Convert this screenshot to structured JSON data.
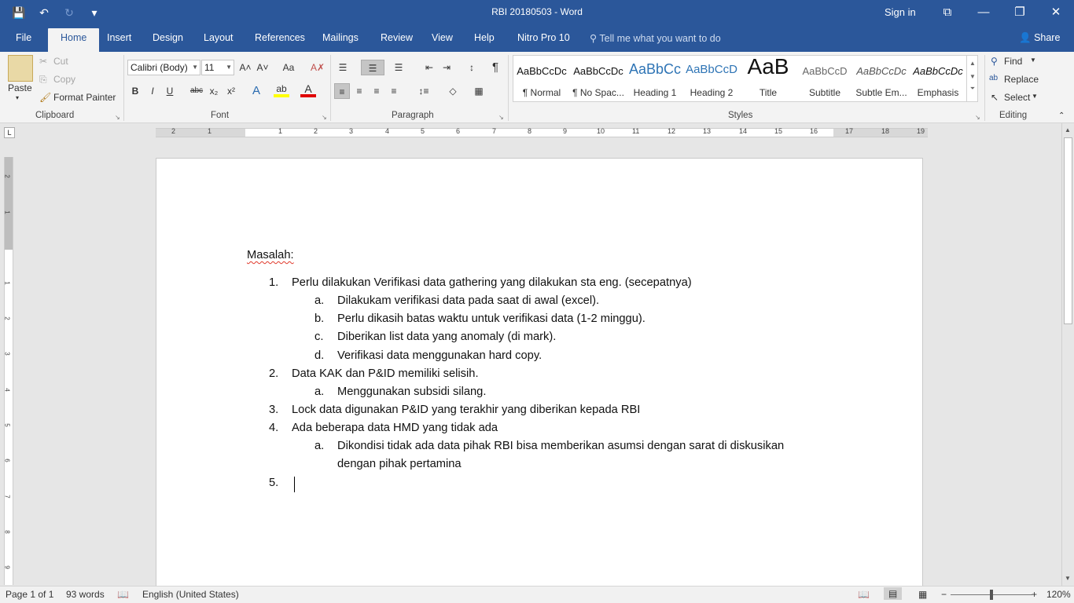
{
  "window": {
    "title": "RBI 20180503  -  Word",
    "signin": "Sign in",
    "btn_ribbon_display": "⧉",
    "btn_minimize": "—",
    "btn_restore": "❐",
    "btn_close": "✕"
  },
  "qat": {
    "save": "💾",
    "undo": "↶",
    "redo": "↻",
    "customize": "▾"
  },
  "tabs": [
    "File",
    "Home",
    "Insert",
    "Design",
    "Layout",
    "References",
    "Mailings",
    "Review",
    "View",
    "Help",
    "Nitro Pro 10"
  ],
  "tellme": {
    "icon": "⚲",
    "placeholder": "Tell me what you want to do"
  },
  "share": {
    "icon": "👤",
    "label": "Share"
  },
  "clipboard": {
    "paste": "Paste",
    "cut": "Cut",
    "copy": "Copy",
    "format_painter": "Format Painter",
    "group": "Clipboard"
  },
  "font": {
    "name": "Calibri (Body)",
    "size": "11",
    "grow": "A˄",
    "shrink": "A˅",
    "case": "Aa",
    "clear": "A✗",
    "bold": "B",
    "italic": "I",
    "underline": "U",
    "strike": "abc",
    "subscript": "x₂",
    "superscript": "x²",
    "effects": "A",
    "highlight": "ab",
    "color": "A",
    "group": "Font"
  },
  "paragraph": {
    "bullets": "☰",
    "numbering": "☰",
    "multilevel": "☰",
    "dec_indent": "⇤",
    "inc_indent": "⇥",
    "sort": "↕",
    "pilcrow": "¶",
    "align_left": "≡",
    "center": "≡",
    "align_right": "≡",
    "justify": "≡",
    "line_spacing": "↕≡",
    "shading": "◇",
    "borders": "▦",
    "group": "Paragraph"
  },
  "styles": {
    "group": "Styles",
    "items": [
      {
        "preview": "AaBbCcDc",
        "name": "¶ Normal"
      },
      {
        "preview": "AaBbCcDc",
        "name": "¶ No Spac..."
      },
      {
        "preview": "AaBbCc",
        "name": "Heading 1"
      },
      {
        "preview": "AaBbCcD",
        "name": "Heading 2"
      },
      {
        "preview": "AaB",
        "name": "Title"
      },
      {
        "preview": "AaBbCcD",
        "name": "Subtitle"
      },
      {
        "preview": "AaBbCcDc",
        "name": "Subtle Em..."
      },
      {
        "preview": "AaBbCcDc",
        "name": "Emphasis"
      }
    ]
  },
  "editing": {
    "find": "Find",
    "replace": "Replace",
    "select": "Select",
    "group": "Editing"
  },
  "ruler": {
    "tab_selector": "L",
    "numbers": [
      "2",
      "1",
      "1",
      "2",
      "3",
      "4",
      "5",
      "6",
      "7",
      "8",
      "9",
      "10",
      "11",
      "12",
      "13",
      "14",
      "15",
      "16",
      "17",
      "18",
      "19"
    ],
    "vnumbers": [
      "2",
      "1",
      "1",
      "2",
      "3",
      "4",
      "5",
      "6",
      "7",
      "8",
      "9"
    ]
  },
  "document": {
    "heading": "Masalah:",
    "items": [
      {
        "num": "1.",
        "level": 1,
        "text": "Perlu dilakukan Verifikasi data gathering yang dilakukan sta eng. (secepatnya)"
      },
      {
        "num": "a.",
        "level": 2,
        "text": "Dilakukam verifikasi data pada saat di awal (excel)."
      },
      {
        "num": "b.",
        "level": 2,
        "text": "Perlu dikasih batas waktu untuk verifikasi data (1-2 minggu)."
      },
      {
        "num": "c.",
        "level": 2,
        "text": "Diberikan list data yang anomaly (di mark)."
      },
      {
        "num": "d.",
        "level": 2,
        "text": "Verifikasi data menggunakan hard copy."
      },
      {
        "num": "2.",
        "level": 1,
        "text": "Data KAK dan P&ID memiliki selisih."
      },
      {
        "num": "a.",
        "level": 2,
        "text": "Menggunakan subsidi silang."
      },
      {
        "num": "3.",
        "level": 1,
        "text": "Lock data digunakan P&ID yang terakhir yang diberikan kepada RBI"
      },
      {
        "num": "4.",
        "level": 1,
        "text": "Ada beberapa data HMD yang tidak ada"
      },
      {
        "num": "a.",
        "level": 2,
        "text": "Dikondisi tidak ada data pihak RBI bisa memberikan asumsi dengan sarat di diskusikan"
      },
      {
        "num": "",
        "level": 2,
        "text": "dengan pihak pertamina"
      },
      {
        "num": "5.",
        "level": 1,
        "text": ""
      }
    ]
  },
  "status": {
    "page": "Page 1 of 1",
    "words": "93 words",
    "proof_icon": "📖",
    "language": "English (United States)",
    "zoom_minus": "−",
    "zoom_plus": "+",
    "zoom": "120%"
  }
}
